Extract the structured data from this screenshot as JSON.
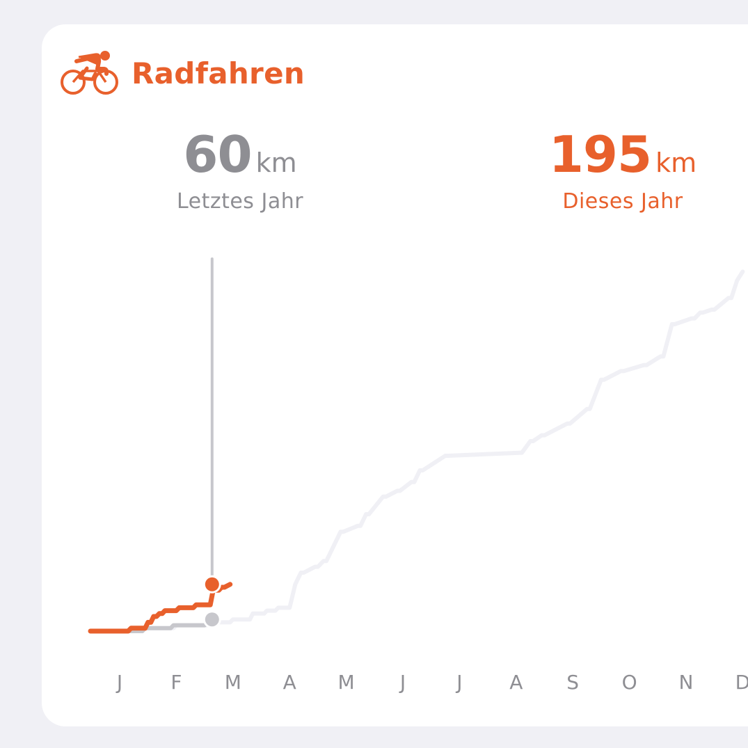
{
  "header": {
    "title": "Radfahren",
    "icon": "bicycle-icon",
    "accent_color": "#E8602C"
  },
  "last_year": {
    "value": "60",
    "unit": "km",
    "caption": "Letztes Jahr",
    "color": "#8E8E93"
  },
  "this_year": {
    "value": "195",
    "unit": "km",
    "caption": "Dieses Jahr",
    "color": "#E8602C"
  },
  "chart_data": {
    "type": "line",
    "x_unit": "month",
    "y_unit": "km",
    "months": [
      "J",
      "F",
      "M",
      "A",
      "M",
      "J",
      "J",
      "A",
      "S",
      "O",
      "N",
      "D"
    ],
    "marker_month": 2.0,
    "series": [
      {
        "color": "#F0F0F5",
        "x": [
          0,
          0.4,
          0.45,
          0.95,
          1.0,
          1.55,
          1.6,
          1.95,
          2.0,
          2.3,
          2.35,
          2.55,
          2.6,
          2.75,
          2.8,
          3.0,
          3.05,
          3.1,
          3.2,
          3.25,
          3.45,
          3.5,
          3.6,
          3.65,
          3.9,
          3.95,
          4.2,
          4.25,
          4.35,
          4.4,
          4.65,
          4.7,
          4.9,
          4.95,
          5.15,
          5.2,
          5.3,
          5.35,
          5.75,
          5.8,
          7.05,
          7.1,
          7.25,
          7.3,
          7.45,
          7.5,
          7.9,
          7.95,
          8.25,
          8.3,
          8.5,
          8.55,
          8.85,
          8.9,
          9.25,
          9.3,
          9.55,
          9.6,
          9.75,
          9.8,
          10.1,
          10.15,
          10.25,
          10.3,
          10.45,
          10.5,
          10.75,
          10.8,
          10.9,
          11.0
        ],
        "y": [
          0,
          0,
          1,
          1,
          2,
          2,
          3,
          3,
          4,
          4,
          6,
          6,
          7,
          7,
          8,
          8,
          12,
          16,
          20,
          20,
          22,
          22,
          24,
          24,
          34,
          34,
          36,
          36,
          40,
          40,
          46,
          46,
          48,
          48,
          51,
          51,
          55,
          55,
          60,
          60,
          61,
          61,
          65,
          65,
          67,
          67,
          71,
          71,
          76,
          76,
          86,
          86,
          89,
          89,
          91,
          91,
          94,
          94,
          105,
          105,
          107,
          107,
          109,
          109,
          110,
          110,
          114,
          114,
          120,
          123
        ]
      },
      {
        "color": "#C7C7CC",
        "x": [
          0,
          0.4,
          0.45,
          0.9,
          0.95,
          1.5,
          1.55,
          1.6
        ],
        "y": [
          0,
          0,
          1,
          1,
          2,
          2,
          3,
          4
        ]
      },
      {
        "color": "#E8602C",
        "x": [
          0,
          0.15,
          0.2,
          0.45,
          0.5,
          0.55,
          0.6,
          0.65,
          0.7,
          0.75,
          0.8,
          1.0,
          1.05,
          1.3,
          1.35,
          1.6,
          1.65,
          1.75,
          1.8,
          1.85,
          1.95
        ],
        "y": [
          0,
          0,
          1,
          1,
          3,
          3,
          5,
          5,
          6,
          6,
          7,
          7,
          8,
          8,
          9,
          9,
          14,
          14,
          15,
          15,
          16
        ]
      }
    ]
  }
}
